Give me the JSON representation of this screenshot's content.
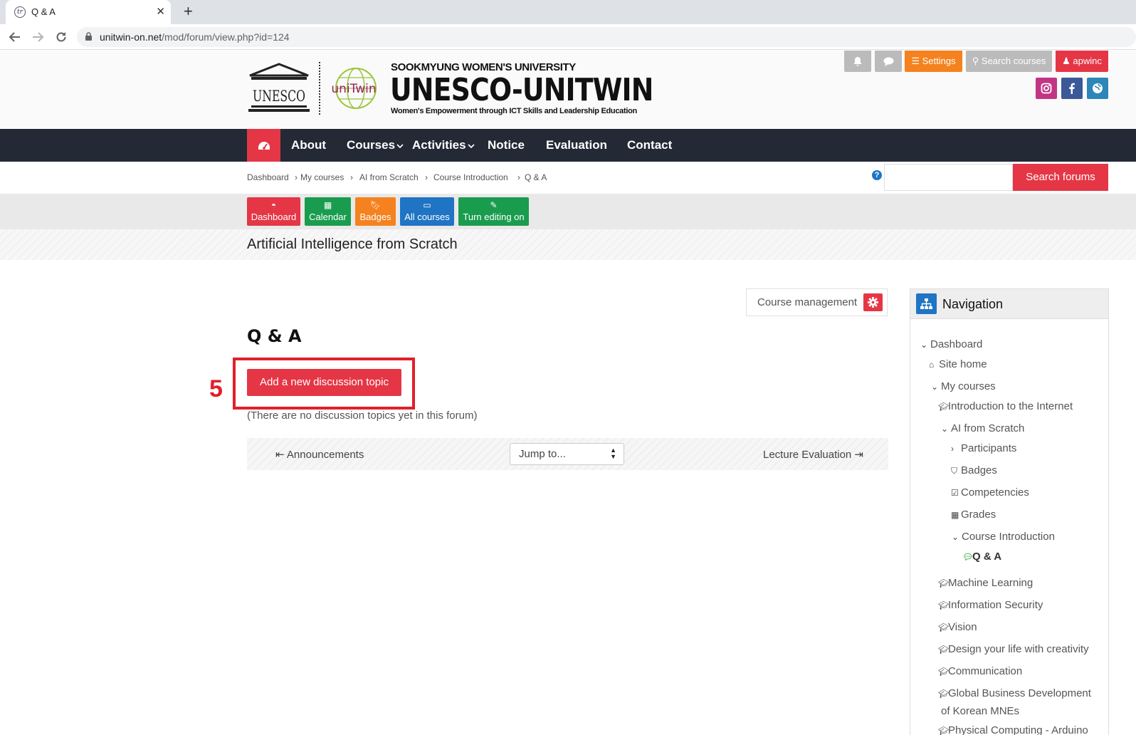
{
  "browser": {
    "tab_title": "Q & A",
    "new_tab": "+",
    "close": "✕",
    "url_host": "unitwin-on.net",
    "url_path": "/mod/forum/view.php?id=124"
  },
  "header": {
    "logo_unesco_text": "UNESCO",
    "logo_unitwin_text": "uniTwin",
    "university": "SOOKMYUNG WOMEN'S UNIVERSITY",
    "brand": "UNESCO-UNITWIN",
    "tagline": "Women's Empowerment through ICT Skills and Leadership Education",
    "settings_label": "Settings",
    "search_courses_label": "Search courses",
    "user_label": "apwinc"
  },
  "nav": {
    "items": [
      "About",
      "Courses",
      "Activities",
      "Notice",
      "Evaluation",
      "Contact"
    ]
  },
  "breadcrumb": [
    "Dashboard",
    "My courses",
    "AI from Scratch",
    "Course Introduction",
    "Q & A"
  ],
  "search": {
    "button": "Search forums",
    "help": "?"
  },
  "quicklinks": [
    "Dashboard",
    "Calendar",
    "Badges",
    "All courses",
    "Turn editing on"
  ],
  "course": {
    "title": "Artificial Intelligence from Scratch"
  },
  "main": {
    "course_management": "Course management",
    "page_title": "Q & A",
    "step_number": "5",
    "add_button": "Add a new discussion topic",
    "no_topics": "(There are no discussion topics yet in this forum)",
    "prev_activity": "Announcements",
    "jump_to": "Jump to...",
    "next_activity": "Lecture Evaluation"
  },
  "navigation": {
    "title": "Navigation",
    "items": [
      "Dashboard",
      "Site home",
      "My courses",
      "Introduction to the Internet",
      "AI from Scratch",
      "Participants",
      "Badges",
      "Competencies",
      "Grades",
      "Course Introduction",
      "Q & A",
      "Machine Learning",
      "Information Security",
      "Vision",
      "Design your life with creativity",
      "Communication",
      "Global Business Development",
      "of Korean MNEs",
      "Physical Computing - Arduino"
    ]
  },
  "colors": {
    "accent_red": "#e53646",
    "nav_dark": "#232a36",
    "orange": "#f5821f",
    "green": "#1a9c4f",
    "blue": "#1f74c4",
    "highlight": "#e0202a"
  }
}
